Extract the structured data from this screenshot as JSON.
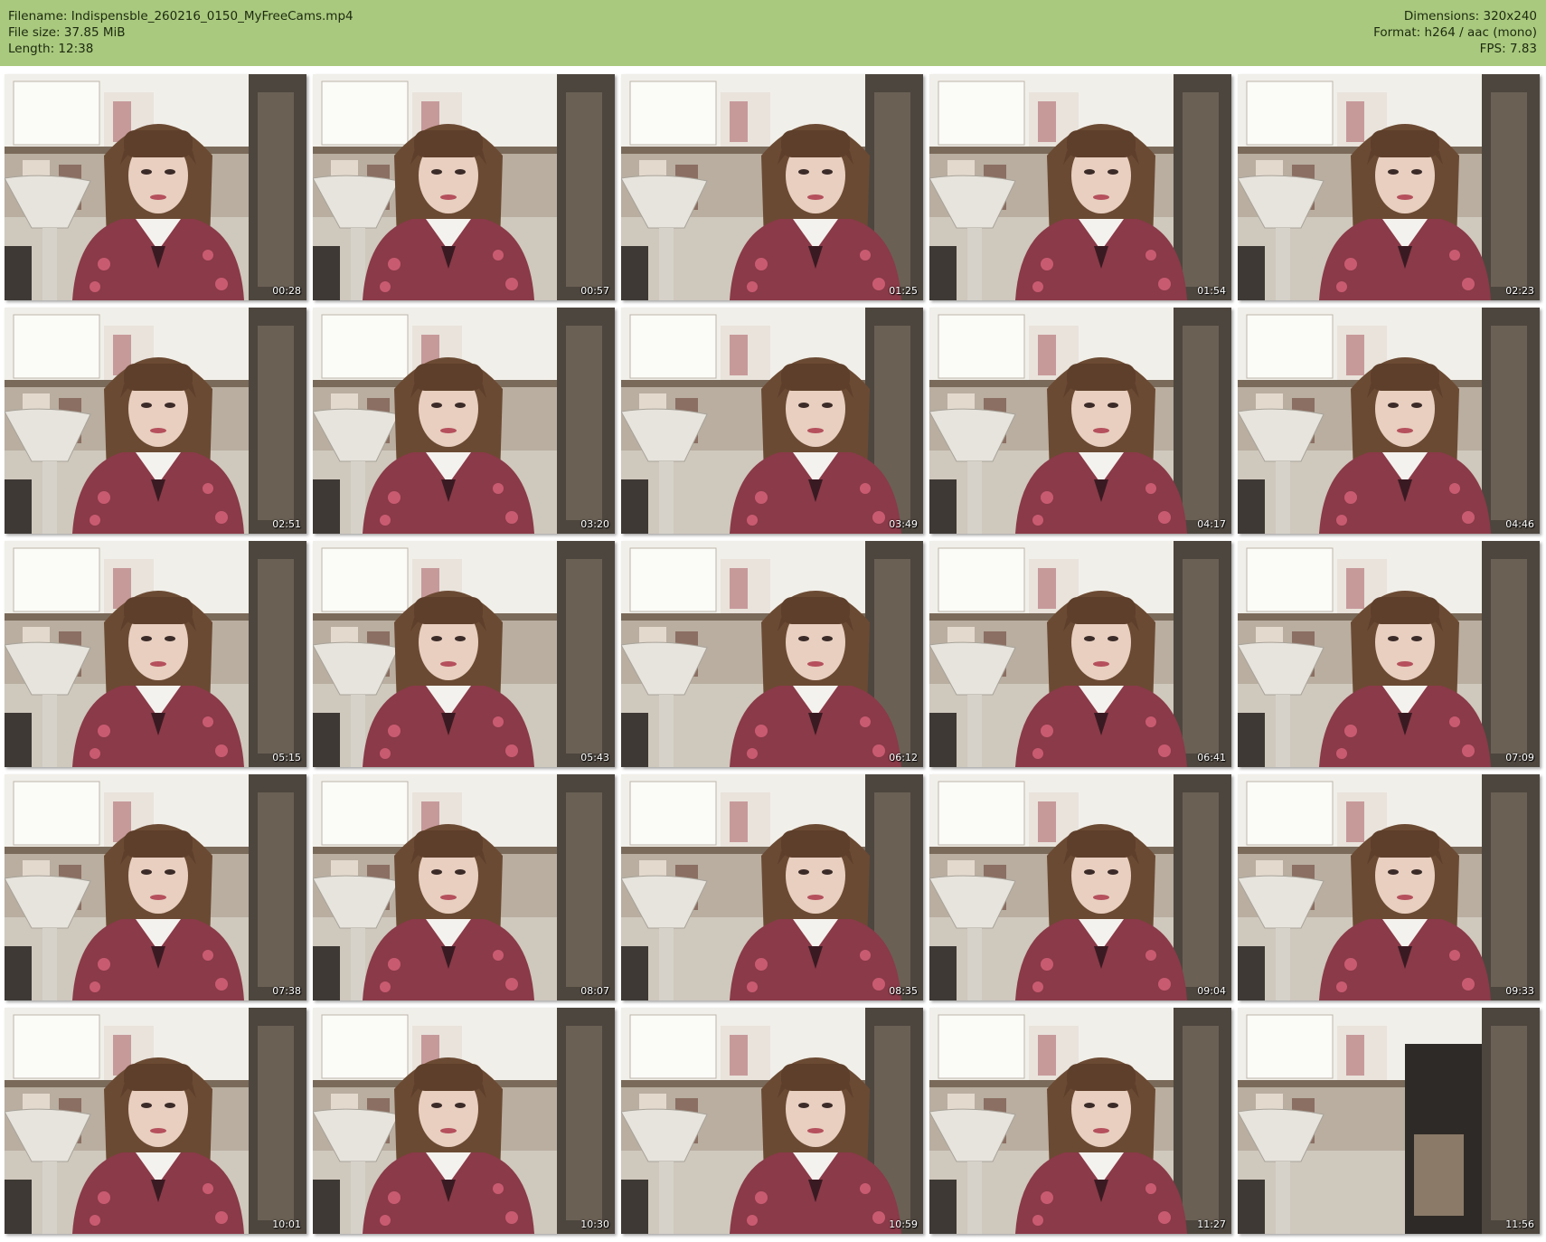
{
  "header": {
    "filename_line": "Filename: Indispensble_260216_0150_MyFreeCams.mp4",
    "filesize_line": "File size: 37.85 MiB",
    "length_line": "Length: 12:38",
    "dimensions_line": "Dimensions: 320x240",
    "format_line": "Format: h264 / aac (mono)",
    "fps_line": "FPS: 7.83"
  },
  "colors": {
    "header_bg": "#a9c97e",
    "page_bg": "#ffffff",
    "timestamp": "#ffffff"
  },
  "thumbnails": [
    {
      "time": "00:28"
    },
    {
      "time": "00:57"
    },
    {
      "time": "01:25"
    },
    {
      "time": "01:54"
    },
    {
      "time": "02:23"
    },
    {
      "time": "02:51"
    },
    {
      "time": "03:20"
    },
    {
      "time": "03:49"
    },
    {
      "time": "04:17"
    },
    {
      "time": "04:46"
    },
    {
      "time": "05:15"
    },
    {
      "time": "05:43"
    },
    {
      "time": "06:12"
    },
    {
      "time": "06:41"
    },
    {
      "time": "07:09"
    },
    {
      "time": "07:38"
    },
    {
      "time": "08:07"
    },
    {
      "time": "08:35"
    },
    {
      "time": "09:04"
    },
    {
      "time": "09:33"
    },
    {
      "time": "10:01"
    },
    {
      "time": "10:30"
    },
    {
      "time": "10:59"
    },
    {
      "time": "11:27"
    },
    {
      "time": "11:56"
    }
  ]
}
